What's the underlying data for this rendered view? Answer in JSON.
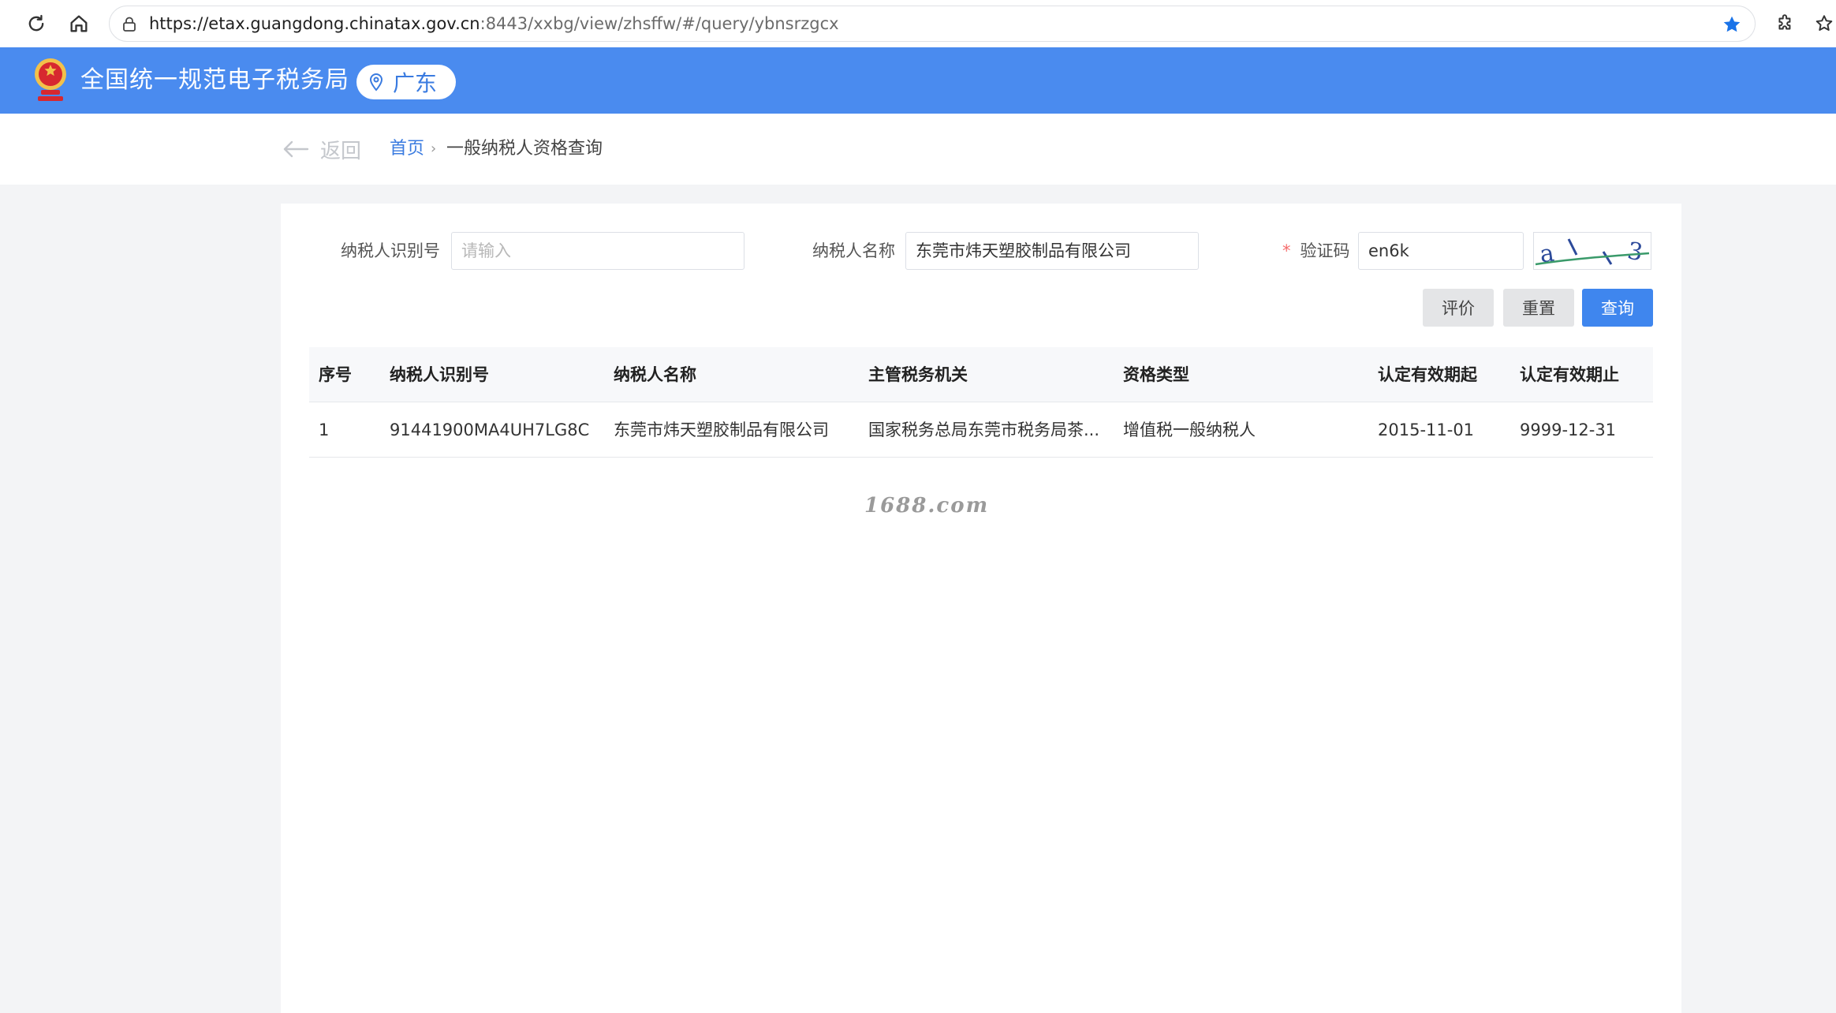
{
  "browser": {
    "url_host": "https://etax.guangdong.chinatax.gov.cn",
    "url_path": ":8443/xxbg/view/zhsffw/#/query/ybnsrzgcx"
  },
  "header": {
    "title": "全国统一规范电子税务局",
    "region": "广东",
    "brand_color": "#4a8bef"
  },
  "breadcrumb": {
    "back_label": "返回",
    "home_label": "首页",
    "separator": "›",
    "current_label": "一般纳税人资格查询"
  },
  "form": {
    "taxpayer_id_label": "纳税人识别号",
    "taxpayer_id_value": "",
    "taxpayer_id_placeholder": "请输入",
    "taxpayer_name_label": "纳税人名称",
    "taxpayer_name_value": "东莞市炜天塑胶制品有限公司",
    "captcha_required_mark": "*",
    "captcha_label": "验证码",
    "captcha_value": "en6k",
    "captcha_image_text": "a\\\\3"
  },
  "buttons": {
    "evaluate_label": "评价",
    "reset_label": "重置",
    "query_label": "查询",
    "query_color": "#3f86ee"
  },
  "table": {
    "headers": [
      "序号",
      "纳税人识别号",
      "纳税人名称",
      "主管税务机关",
      "资格类型",
      "认定有效期起",
      "认定有效期止"
    ],
    "rows": [
      [
        "1",
        "91441900MA4UH7LG8C",
        "东莞市炜天塑胶制品有限公司",
        "国家税务总局东莞市税务局茶...",
        "增值税一般纳税人",
        "2015-11-01",
        "9999-12-31"
      ]
    ]
  },
  "watermark": "1688.com"
}
